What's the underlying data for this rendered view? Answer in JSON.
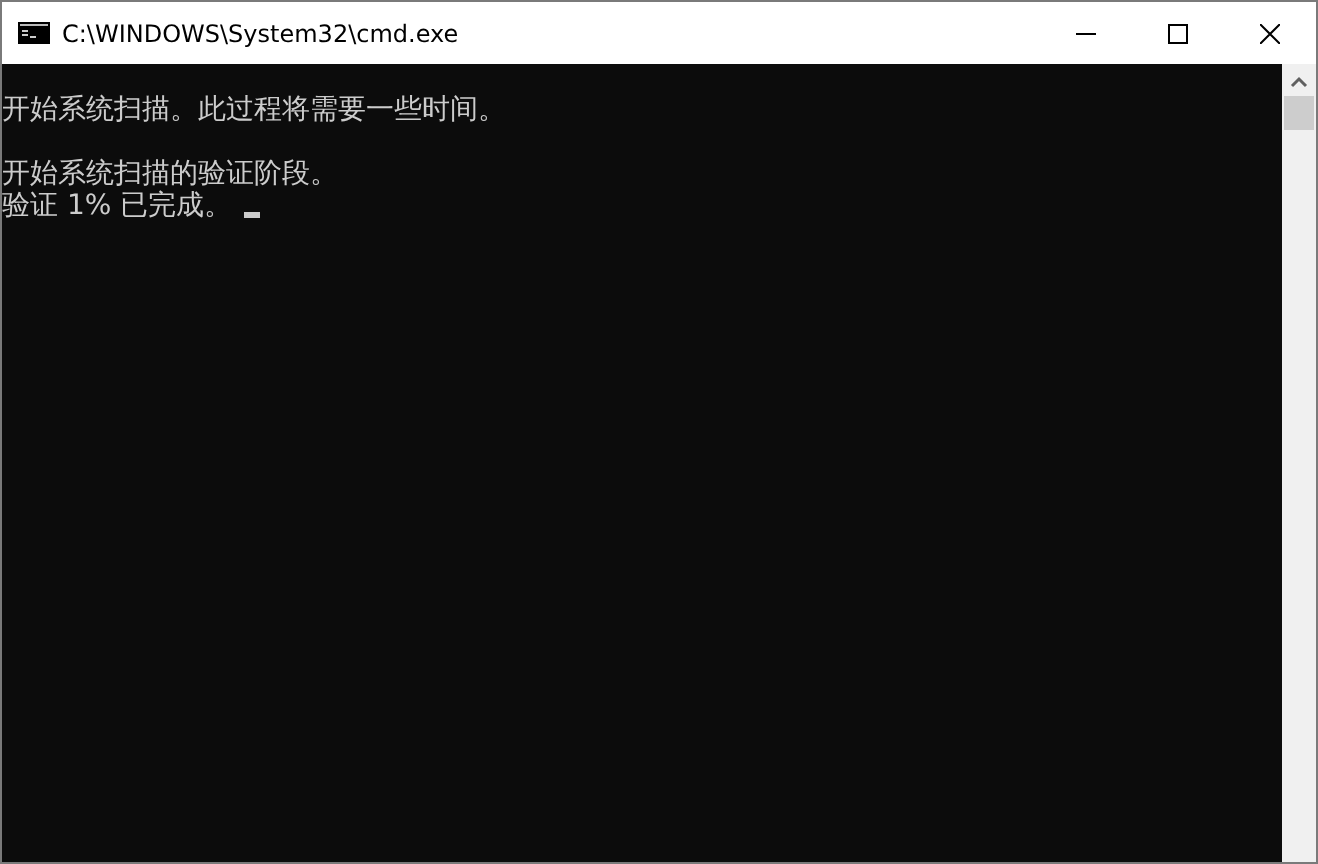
{
  "window": {
    "title": "C:\\WINDOWS\\System32\\cmd.exe"
  },
  "console": {
    "blocks": [
      [
        "开始系统扫描。此过程将需要一些时间。"
      ],
      [
        "开始系统扫描的验证阶段。",
        "验证 1% 已完成。"
      ]
    ],
    "cursor": true
  }
}
